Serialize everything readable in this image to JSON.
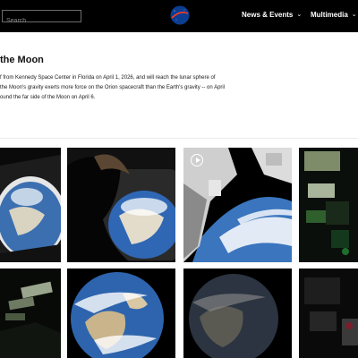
{
  "header": {
    "search_placeholder": "Search",
    "nav": [
      {
        "label": "News & Events"
      },
      {
        "label": "Multimedia"
      }
    ]
  },
  "article": {
    "title_fragment": "the Moon",
    "body_lines": [
      "f from Kennedy Space Center in Florida on April 1, 2026, and will reach the lunar sphere of",
      "the Moon's gravity exerts more force on the Orion spacecraft than the Earth's gravity -- on April",
      "ound the far side of the Moon on April 6."
    ]
  },
  "colors": {
    "header_bg": "#000000",
    "text": "#111111",
    "page_bg": "#ffffff"
  }
}
